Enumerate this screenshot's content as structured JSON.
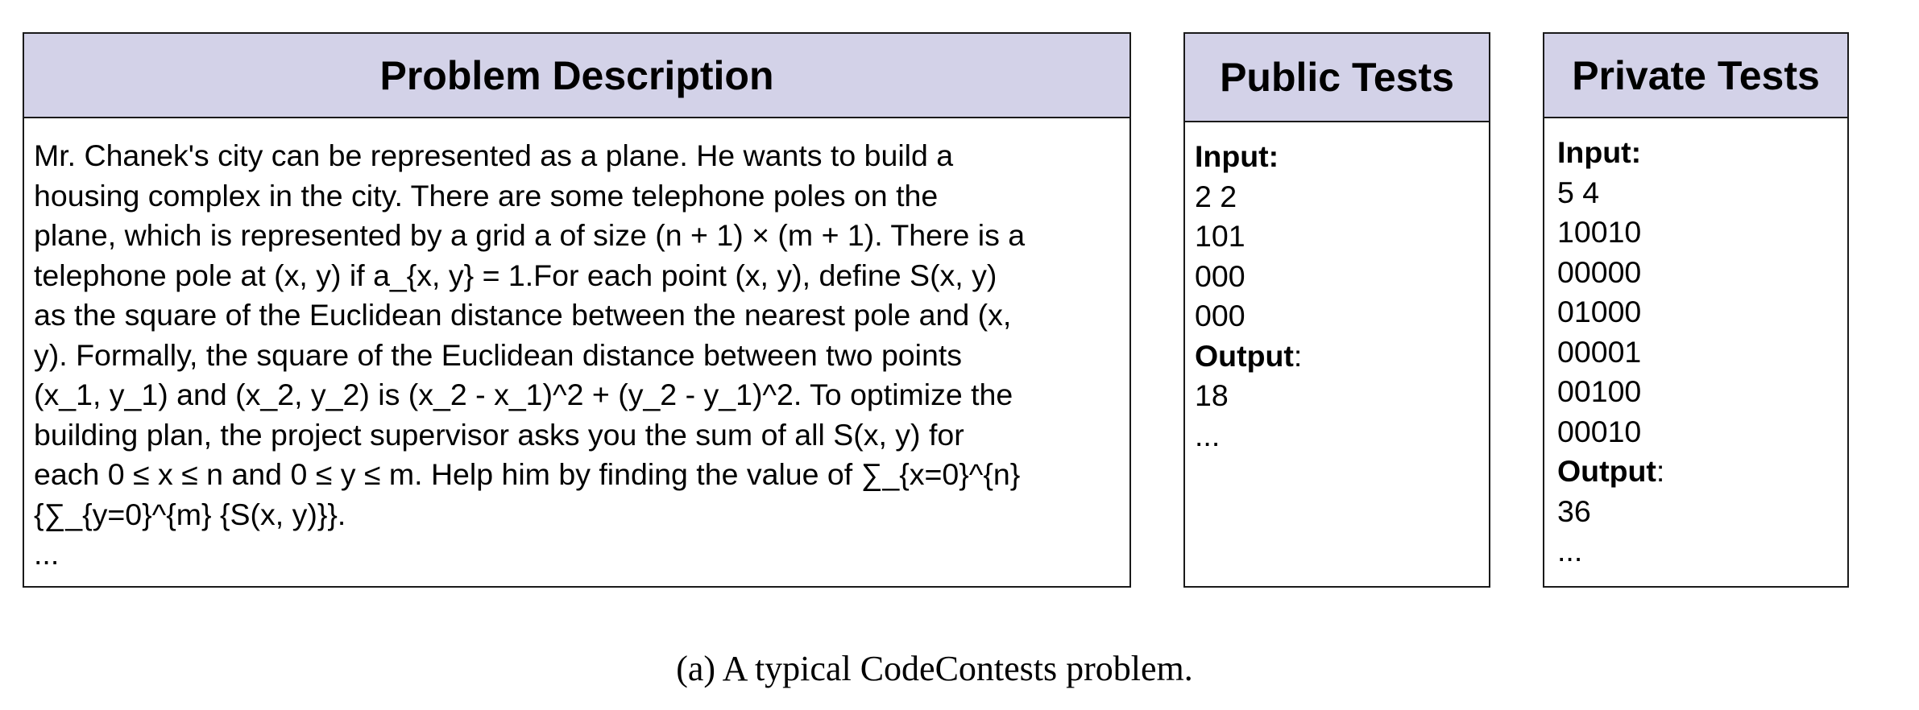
{
  "problem_description": {
    "title": "Problem Description",
    "lines": [
      "Mr. Chanek's city can be represented as a plane. He wants to build a",
      "housing complex in the city. There are some telephone poles on the",
      "plane, which is represented by a grid a of size (n + 1) × (m + 1). There is a",
      "telephone pole at (x, y) if a_{x, y} = 1.For each point (x, y), define S(x, y)",
      "as the square of the Euclidean distance between the nearest pole and (x,",
      "y). Formally, the square of the Euclidean distance between two points",
      "(x_1, y_1) and (x_2, y_2) is (x_2 - x_1)^2 + (y_2 - y_1)^2. To optimize the",
      "building plan, the project supervisor asks you the sum of all S(x, y) for",
      "each 0 ≤ x ≤ n and 0 ≤ y ≤ m. Help him by finding the value of ∑_{x=0}^{n}",
      "{∑_{y=0}^{m} {S(x, y)}}.",
      "..."
    ]
  },
  "public_tests": {
    "title": "Public Tests",
    "input_label": "Input",
    "input_lines": [
      "2 2",
      "101",
      "000",
      "000"
    ],
    "output_label": "Output",
    "output_lines": [
      "18",
      "..."
    ]
  },
  "private_tests": {
    "title": "Private Tests",
    "input_label": "Input",
    "input_lines": [
      "5 4",
      "10010",
      "00000",
      "01000",
      "00001",
      "00100",
      "00010"
    ],
    "output_label": "Output",
    "output_lines": [
      "36",
      "..."
    ]
  },
  "caption": "(a) A typical CodeContests problem."
}
